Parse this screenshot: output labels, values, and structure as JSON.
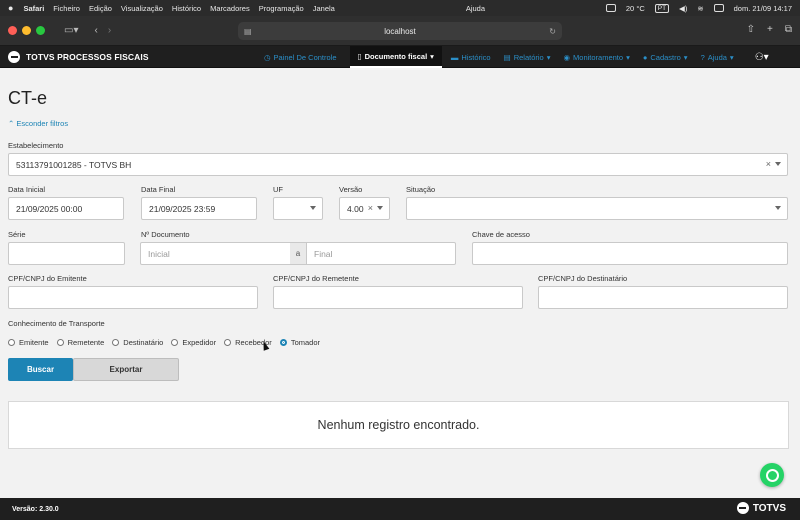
{
  "menubar": {
    "apple": "",
    "items": [
      "Safari",
      "Ficheiro",
      "Edição",
      "Visualização",
      "Histórico",
      "Marcadores",
      "Programação",
      "Janela"
    ],
    "help": "Ajuda",
    "temperature": "20 °C",
    "input_lang": "PT",
    "datetime": "dom. 21/09  14:17"
  },
  "browser": {
    "url": "localhost"
  },
  "app": {
    "brand": "TOTVS PROCESSOS FISCAIS",
    "nav": [
      {
        "label": "Painel De Controle",
        "icon": "clock-icon"
      },
      {
        "label": "Documento fiscal",
        "icon": "document-icon",
        "active": true
      },
      {
        "label": "Histórico",
        "icon": "folder-icon"
      },
      {
        "label": "Relatório",
        "icon": "report-icon"
      },
      {
        "label": "Monitoramento",
        "icon": "eye-icon"
      },
      {
        "label": "Cadastro",
        "icon": "user-icon"
      },
      {
        "label": "Ajuda",
        "icon": "help-icon"
      }
    ]
  },
  "page": {
    "title": "CT-e",
    "toggle_filters": "Esconder filtros"
  },
  "filters": {
    "estabelecimento": {
      "label": "Estabelecimento",
      "value": "53113791001285 - TOTVS BH"
    },
    "data_inicial": {
      "label": "Data Inicial",
      "value": "21/09/2025 00:00"
    },
    "data_final": {
      "label": "Data Final",
      "value": "21/09/2025 23:59"
    },
    "uf": {
      "label": "UF",
      "value": ""
    },
    "versao": {
      "label": "Versão",
      "value": "4.00"
    },
    "situacao": {
      "label": "Situação",
      "value": ""
    },
    "serie": {
      "label": "Série",
      "value": ""
    },
    "numero_documento": {
      "label": "Nº Documento",
      "inicial_placeholder": "Inicial",
      "separator": "a",
      "final_placeholder": "Final"
    },
    "chave_acesso": {
      "label": "Chave de acesso",
      "value": ""
    },
    "cpf_emitente": {
      "label": "CPF/CNPJ do Emitente",
      "value": ""
    },
    "cpf_remetente": {
      "label": "CPF/CNPJ do Remetente",
      "value": ""
    },
    "cpf_destinatario": {
      "label": "CPF/CNPJ do Destinatário",
      "value": ""
    },
    "conhecimento": {
      "label": "Conhecimento de Transporte",
      "options": [
        "Emitente",
        "Remetente",
        "Destinatário",
        "Expedidor",
        "Recebedor",
        "Tomador"
      ],
      "selected": "Tomador"
    }
  },
  "actions": {
    "buscar": "Buscar",
    "exportar": "Exportar"
  },
  "results": {
    "empty_message": "Nenhum registro encontrado."
  },
  "footer": {
    "version": "Versão: 2.30.0",
    "logo_text": "TOTVS"
  },
  "colors": {
    "accent": "#1d84b5",
    "nav_link": "#2b8fc8",
    "header_bg": "#1f1f1f",
    "page_bg": "#f2f2f2",
    "whatsapp": "#25d366"
  }
}
